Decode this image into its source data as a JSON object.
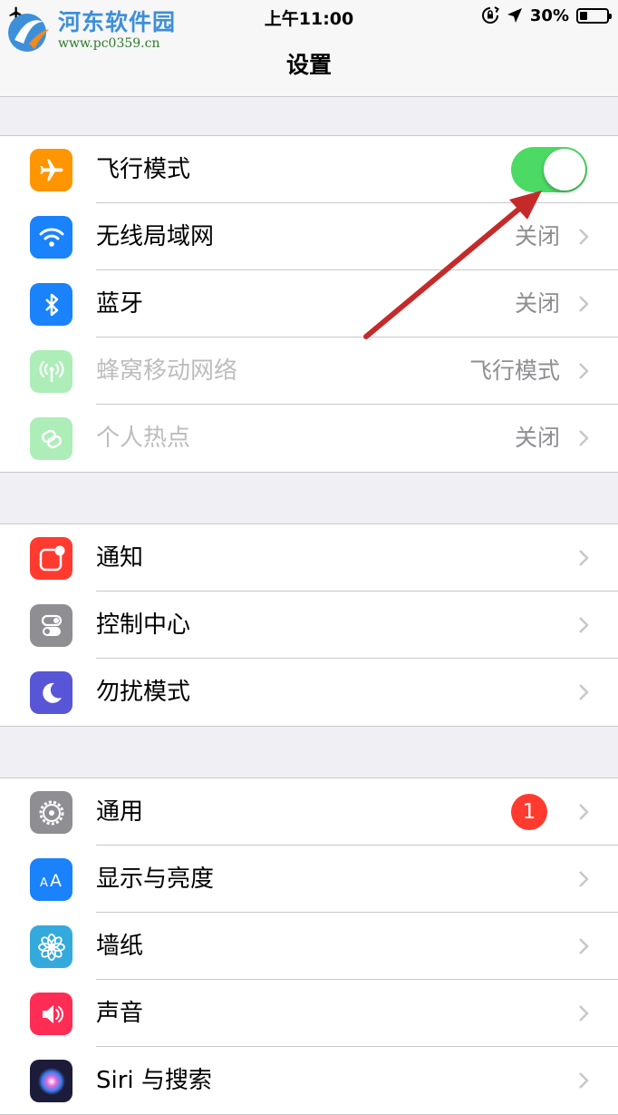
{
  "status_bar": {
    "time": "上午11:00",
    "battery_text": "30%",
    "battery_level": 0.3
  },
  "watermark": {
    "name": "河东软件园",
    "url": "www.pc0359.cn"
  },
  "nav": {
    "title": "设置"
  },
  "groups": [
    {
      "items": [
        {
          "label": "飞行模式",
          "icon": "airplane-icon",
          "color": "#ff9500",
          "control": "toggle",
          "toggle_on": true
        },
        {
          "label": "无线局域网",
          "icon": "wifi-icon",
          "color": "#1a82fb",
          "value": "关闭"
        },
        {
          "label": "蓝牙",
          "icon": "bluetooth-icon",
          "color": "#1a82fb",
          "value": "关闭"
        },
        {
          "label": "蜂窝移动网络",
          "icon": "cellular-icon",
          "color": "#4cd964",
          "value": "飞行模式",
          "disabled": true
        },
        {
          "label": "个人热点",
          "icon": "hotspot-icon",
          "color": "#4cd964",
          "value": "关闭",
          "disabled": true
        }
      ]
    },
    {
      "items": [
        {
          "label": "通知",
          "icon": "notification-icon",
          "color": "#ff3b30"
        },
        {
          "label": "控制中心",
          "icon": "control-center-icon",
          "color": "#8e8e93"
        },
        {
          "label": "勿扰模式",
          "icon": "moon-icon",
          "color": "#5856d6"
        }
      ]
    },
    {
      "items": [
        {
          "label": "通用",
          "icon": "gear-icon",
          "color": "#8e8e93",
          "badge": "1"
        },
        {
          "label": "显示与亮度",
          "icon": "display-icon",
          "color": "#1a82fb"
        },
        {
          "label": "墙纸",
          "icon": "wallpaper-icon",
          "color": "#34aadc"
        },
        {
          "label": "声音",
          "icon": "sound-icon",
          "color": "#ff2d55"
        },
        {
          "label": "Siri 与搜索",
          "icon": "siri-icon",
          "color": "#1c1c3a"
        }
      ]
    }
  ],
  "colors": {
    "toggle_on": "#4cd964",
    "badge": "#ff3b30",
    "annotation_arrow": "#c42a2a"
  }
}
